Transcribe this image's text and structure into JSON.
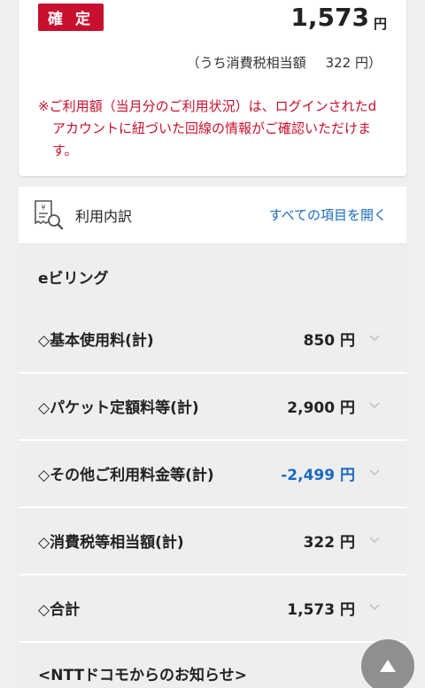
{
  "summary": {
    "status_badge": "確 定",
    "total_amount": "1,573",
    "total_unit": "円",
    "tax_prefix": "（うち消費税相当額",
    "tax_value": "322 円）",
    "notice": "※ご利用額（当月分のご利用状況）は、ログインされたdアカウントに紐づいた回線の情報がご確認いただけます。"
  },
  "breakdown": {
    "title": "利用内訳",
    "expand_all_link": "すべての項目を開く",
    "section_label": "eビリング",
    "rows": [
      {
        "label": "◇基本使用料(計)",
        "value": "850 円"
      },
      {
        "label": "◇パケット定額料等(計)",
        "value": "2,900 円"
      },
      {
        "label": "◇その他ご利用料金等(計)",
        "value": "-2,499 円"
      },
      {
        "label": "◇消費税等相当額(計)",
        "value": "322 円"
      },
      {
        "label": "◇合計",
        "value": "1,573 円"
      }
    ],
    "info_row_label": "<NTTドコモからのお知らせ>"
  },
  "colors": {
    "accent_red": "#c8102e",
    "link_blue": "#1a6ac0",
    "negative_blue": "#1a6ac0"
  },
  "icons": {
    "receipt": "receipt-yen-magnifier-icon",
    "chevron": "chevron-down-icon",
    "scroll_top": "triangle-up-icon"
  }
}
